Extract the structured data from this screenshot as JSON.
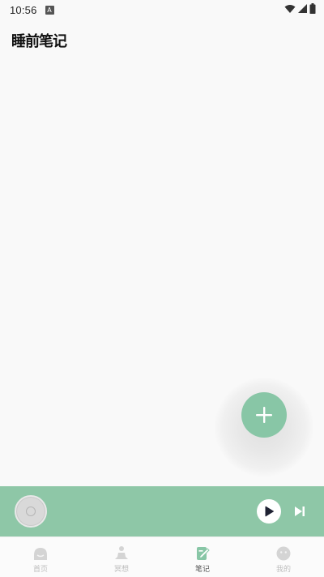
{
  "status": {
    "time": "10:56",
    "notification_icon": "A"
  },
  "header": {
    "title": "睡前笔记"
  },
  "fab": {
    "icon": "plus-icon"
  },
  "player": {
    "play_icon": "play-icon",
    "next_icon": "skip-next-icon"
  },
  "nav": {
    "items": [
      {
        "label": "首页",
        "icon": "home-icon",
        "active": false
      },
      {
        "label": "冥想",
        "icon": "meditation-icon",
        "active": false
      },
      {
        "label": "笔记",
        "icon": "note-edit-icon",
        "active": true
      },
      {
        "label": "我的",
        "icon": "profile-icon",
        "active": false
      }
    ]
  },
  "colors": {
    "accent": "#88c6a6",
    "player_bg": "#8ec7a7",
    "inactive": "#bdbdbd"
  }
}
